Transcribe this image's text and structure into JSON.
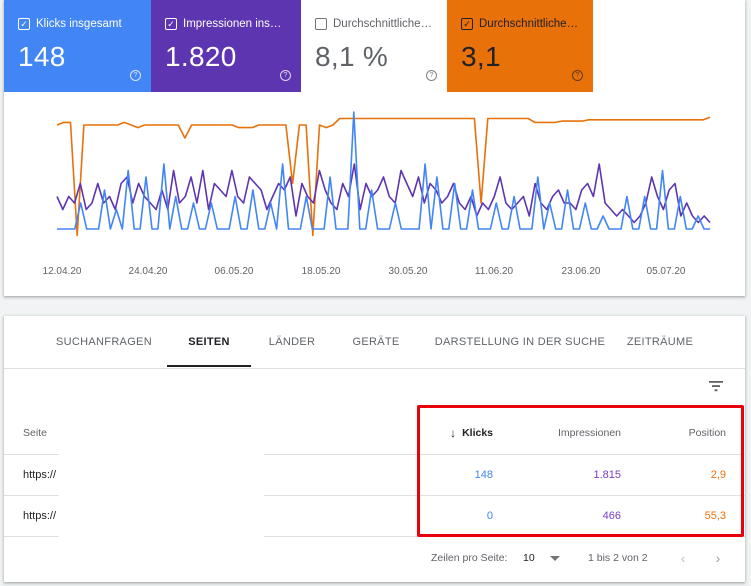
{
  "metrics": {
    "clicks": {
      "label": "Klicks insgesamt",
      "value": "148",
      "checked": true,
      "color": "#4285f4"
    },
    "impressions": {
      "label": "Impressionen ins…",
      "value": "1.820",
      "checked": true,
      "color": "#5e35b1"
    },
    "ctr": {
      "label": "Durchschnittliche…",
      "value": "8,1 %",
      "checked": false
    },
    "position": {
      "label": "Durchschnittliche…",
      "value": "3,1",
      "checked": true,
      "color": "#e8710a"
    },
    "help_symbol": "?",
    "check_symbol": "✓"
  },
  "chart_data": {
    "type": "line",
    "x_tick_labels": [
      "12.04.20",
      "24.04.20",
      "06.05.20",
      "18.05.20",
      "30.05.20",
      "11.06.20",
      "23.06.20",
      "05.07.20"
    ],
    "series": [
      {
        "key": "position",
        "color": "#e8710a",
        "values": [
          0.9,
          0.92,
          0.92,
          0.05,
          0.9,
          0.9,
          0.9,
          0.9,
          0.9,
          0.9,
          0.92,
          0.9,
          0.88,
          0.9,
          0.9,
          0.9,
          0.9,
          0.9,
          0.9,
          0.8,
          0.9,
          0.9,
          0.9,
          0.9,
          0.9,
          0.9,
          0.9,
          0.88,
          0.88,
          0.88,
          0.9,
          0.9,
          0.9,
          0.9,
          0.9,
          0.45,
          0.9,
          0.9,
          0.05,
          0.9,
          0.88,
          0.9,
          0.95,
          0.95,
          0.95,
          0.95,
          0.95,
          0.95,
          0.95,
          0.95,
          0.95,
          0.95,
          0.95,
          0.95,
          0.95,
          0.95,
          0.95,
          0.95,
          0.95,
          0.95,
          0.95,
          0.95,
          0.95,
          0.3,
          0.95,
          0.95,
          0.95,
          0.95,
          0.95,
          0.95,
          0.95,
          0.92,
          0.92,
          0.92,
          0.92,
          0.93,
          0.93,
          0.93,
          0.93,
          0.94,
          0.94,
          0.94,
          0.94,
          0.94,
          0.94,
          0.94,
          0.94,
          0.94,
          0.94,
          0.94,
          0.94,
          0.94,
          0.94,
          0.94,
          0.94,
          0.94,
          0.94,
          0.96
        ]
      },
      {
        "key": "impressions",
        "color": "#5e35b1",
        "values": [
          0.35,
          0.25,
          0.35,
          0.3,
          0.45,
          0.25,
          0.3,
          0.45,
          0.3,
          0.35,
          0.25,
          0.45,
          0.5,
          0.3,
          0.45,
          0.35,
          0.3,
          0.25,
          0.4,
          0.25,
          0.55,
          0.3,
          0.35,
          0.5,
          0.3,
          0.55,
          0.25,
          0.45,
          0.4,
          0.35,
          0.55,
          0.35,
          0.3,
          0.5,
          0.45,
          0.4,
          0.25,
          0.35,
          0.45,
          0.4,
          0.5,
          0.2,
          0.45,
          0.35,
          0.3,
          0.55,
          0.4,
          0.3,
          0.25,
          0.45,
          0.35,
          0.6,
          0.25,
          0.45,
          0.35,
          0.4,
          0.5,
          0.35,
          0.3,
          0.55,
          0.45,
          0.35,
          0.5,
          0.3,
          0.45,
          0.4,
          0.3,
          0.35,
          0.45,
          0.3,
          0.25,
          0.35,
          0.2,
          0.3,
          0.25,
          0.35,
          0.5,
          0.3,
          0.25,
          0.3,
          0.35,
          0.2,
          0.45,
          0.3,
          0.25,
          0.35,
          0.4,
          0.3,
          0.3,
          0.25,
          0.4,
          0.45,
          0.35,
          0.6,
          0.3,
          0.25,
          0.2,
          0.25,
          0.2,
          0.15,
          0.2,
          0.3,
          0.5,
          0.35,
          0.25,
          0.4,
          0.45,
          0.2,
          0.3,
          0.2,
          0.15,
          0.2,
          0.15
        ]
      },
      {
        "key": "clicks",
        "color": "#4285f4",
        "values": [
          0.1,
          0.1,
          0.1,
          0.1,
          0.3,
          0.1,
          0.1,
          0.1,
          0.4,
          0.1,
          0.25,
          0.1,
          0.55,
          0.1,
          0.1,
          0.5,
          0.1,
          0.1,
          0.6,
          0.1,
          0.35,
          0.1,
          0.1,
          0.3,
          0.1,
          0.1,
          0.3,
          0.1,
          0.1,
          0.1,
          0.35,
          0.1,
          0.1,
          0.4,
          0.1,
          0.1,
          0.3,
          0.1,
          0.6,
          0.1,
          0.1,
          0.1,
          0.35,
          0.1,
          0.1,
          0.1,
          0.5,
          0.1,
          0.1,
          0.1,
          1.0,
          0.1,
          0.1,
          0.4,
          0.1,
          0.1,
          0.1,
          0.3,
          0.1,
          0.1,
          0.1,
          0.1,
          0.6,
          0.1,
          0.5,
          0.1,
          0.1,
          0.45,
          0.1,
          0.1,
          0.4,
          0.1,
          0.1,
          0.1,
          0.3,
          0.1,
          0.1,
          0.35,
          0.1,
          0.1,
          0.1,
          0.5,
          0.1,
          0.3,
          0.1,
          0.1,
          0.4,
          0.1,
          0.1,
          0.3,
          0.1,
          0.1,
          0.2,
          0.1,
          0.1,
          0.1,
          0.35,
          0.1,
          0.1,
          0.35,
          0.1,
          0.1,
          0.55,
          0.1,
          0.1,
          0.35,
          0.1,
          0.1,
          0.2,
          0.1,
          0.1
        ]
      }
    ]
  },
  "tabs": [
    "SUCHANFRAGEN",
    "SEITEN",
    "LÄNDER",
    "GERÄTE",
    "DARSTELLUNG IN DER SUCHE",
    "ZEITRÄUME"
  ],
  "active_tab": "SEITEN",
  "table": {
    "headers": {
      "seite": "Seite",
      "klicks": "Klicks",
      "impressionen": "Impressionen",
      "position": "Position"
    },
    "sort_arrow": "↓",
    "rows": [
      {
        "url": "https://",
        "klicks": "148",
        "impressionen": "1.815",
        "position": "2,9"
      },
      {
        "url": "https://",
        "klicks": "0",
        "impressionen": "466",
        "position": "55,3"
      }
    ]
  },
  "pagination": {
    "rows_label": "Zeilen pro Seite:",
    "rows_value": "10",
    "range": "1 bis 2 von 2",
    "prev": "‹",
    "next": "›"
  }
}
